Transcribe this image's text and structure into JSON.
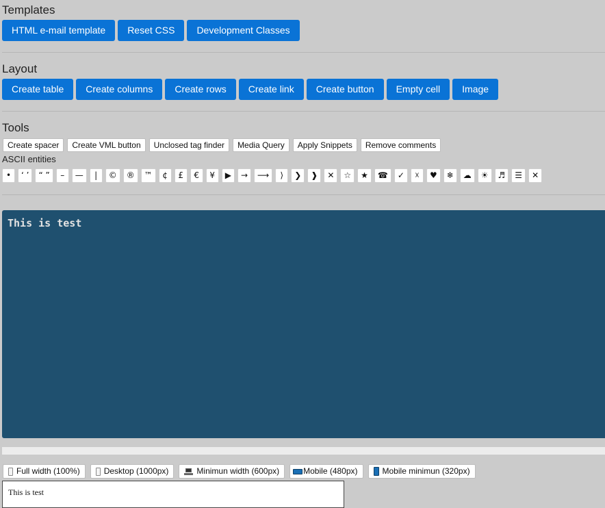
{
  "templates": {
    "title": "Templates",
    "buttons": [
      "HTML e-mail template",
      "Reset CSS",
      "Development Classes"
    ]
  },
  "layout": {
    "title": "Layout",
    "buttons": [
      "Create table",
      "Create columns",
      "Create rows",
      "Create link",
      "Create button",
      "Empty cell",
      "Image"
    ]
  },
  "tools": {
    "title": "Tools",
    "buttons": [
      "Create spacer",
      "Create VML button",
      "Unclosed tag finder",
      "Media Query",
      "Apply Snippets",
      "Remove comments"
    ],
    "ascii_label": "ASCII entities",
    "entities": [
      "•",
      "‘ ’",
      "“ ”",
      "–",
      "—",
      "|",
      "©",
      "®",
      "™",
      "¢",
      "£",
      "€",
      "¥",
      "▶",
      "→",
      "⟶",
      "⟩",
      "❯",
      "❱",
      "✕",
      "☆",
      "★",
      "☎",
      "✓",
      "☓",
      "♥",
      "❄",
      "☁",
      "☀",
      "♬",
      "☰",
      "✕"
    ]
  },
  "editor": {
    "content": "This is test"
  },
  "views": {
    "buttons": [
      {
        "icon": "phone-outline-icon",
        "label": "Full width (100%)"
      },
      {
        "icon": "phone-outline-icon",
        "label": "Desktop (1000px)"
      },
      {
        "icon": "laptop-icon",
        "label": "Minimun width (600px)"
      },
      {
        "icon": "mobile-landscape-icon",
        "label": "Mobile (480px)"
      },
      {
        "icon": "mobile-portrait-icon",
        "label": "Mobile minimun (320px)"
      }
    ]
  },
  "preview": {
    "content": "This is test"
  },
  "colors": {
    "background": "#cbcbcb",
    "primary_button": "#0a73d6",
    "editor_background": "#1f506f"
  }
}
